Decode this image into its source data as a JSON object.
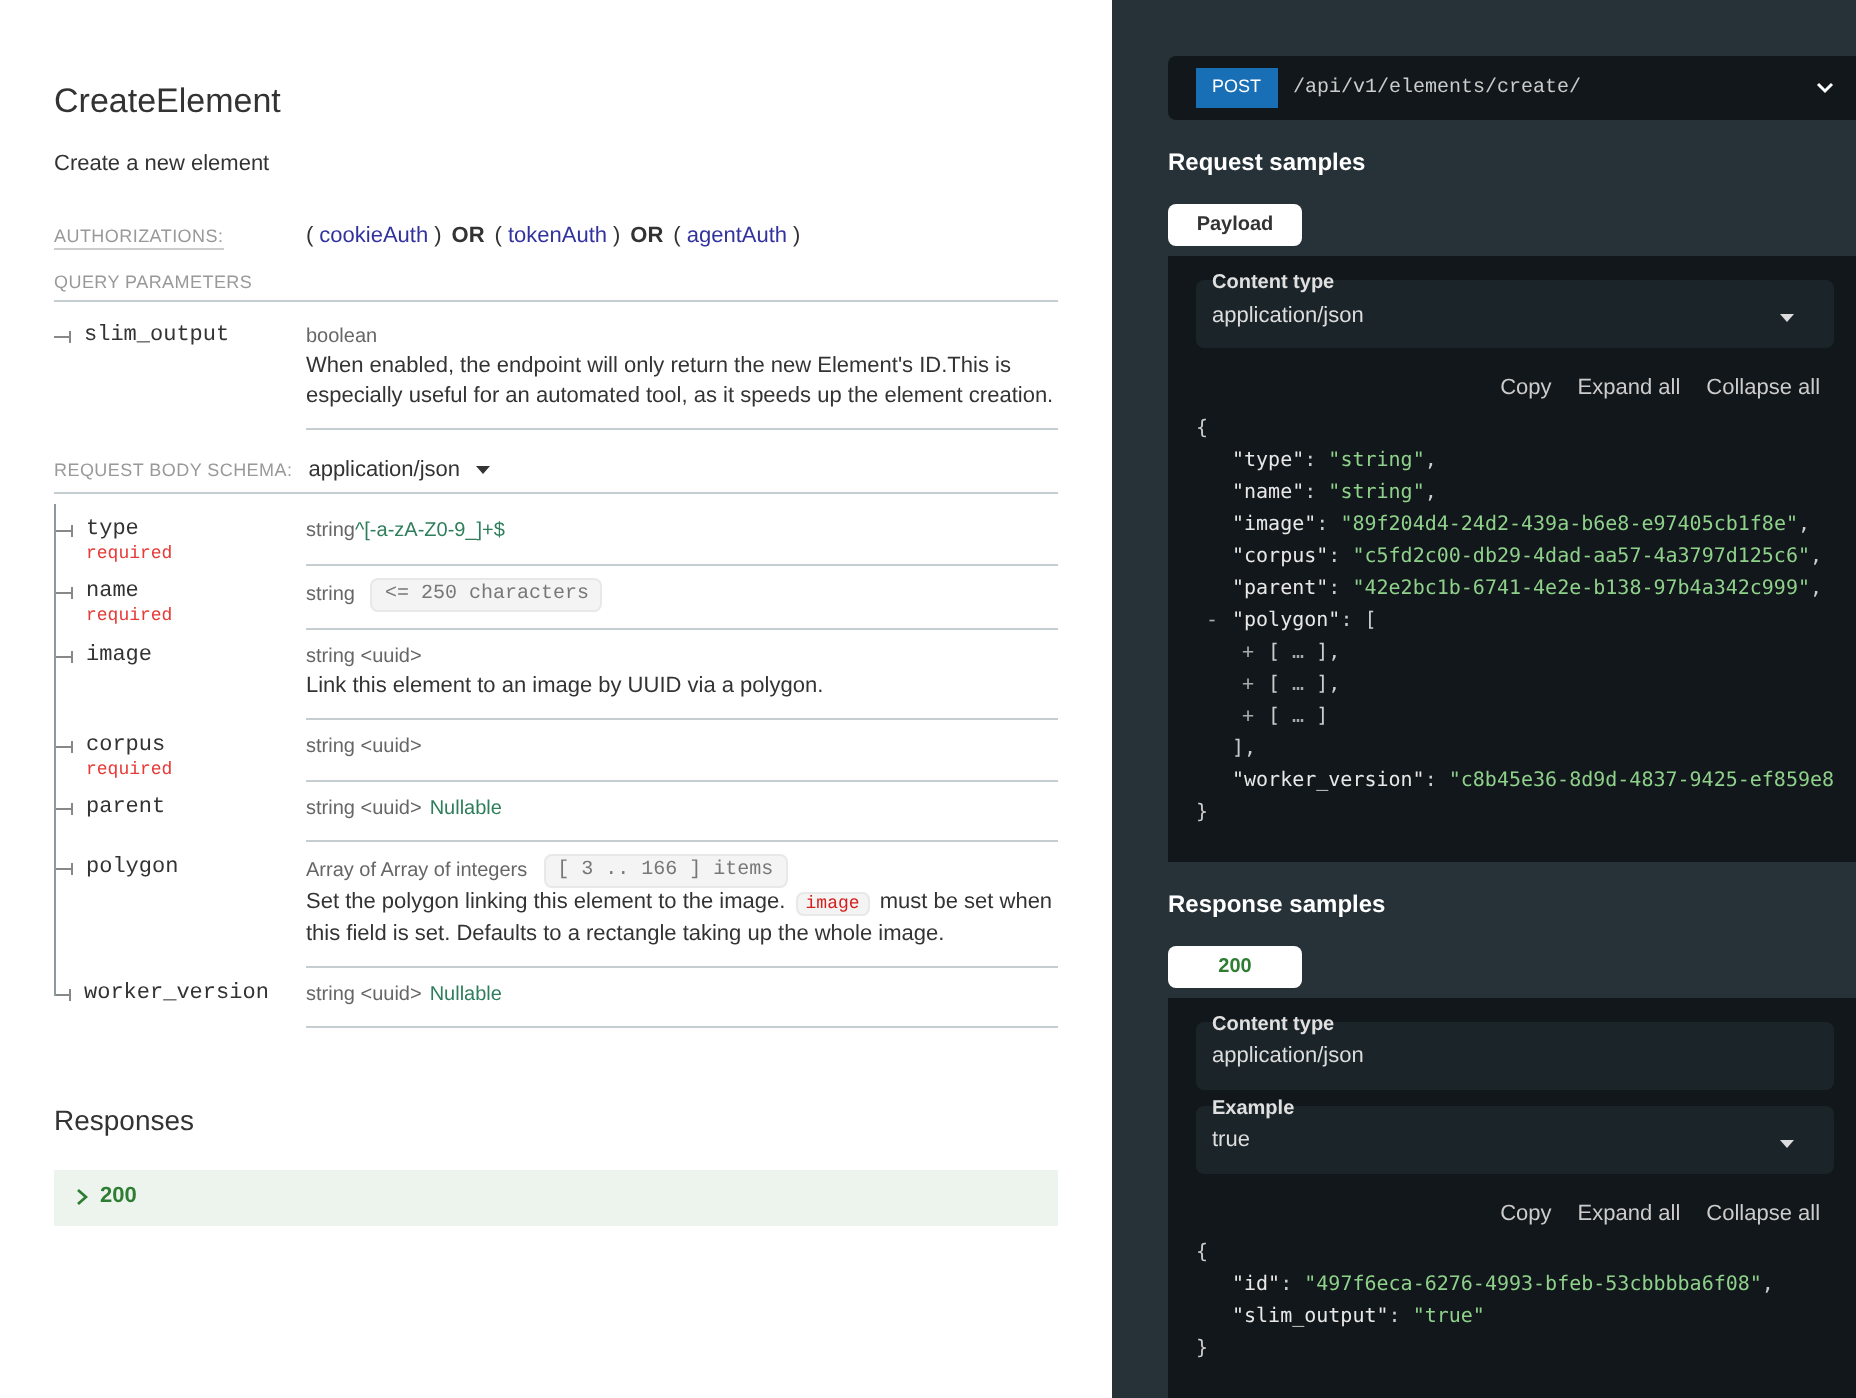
{
  "title": "CreateElement",
  "description": "Create a new element",
  "authorizations": {
    "label": "AUTHORIZATIONS:",
    "parts": [
      {
        "kind": "punct",
        "text": "("
      },
      {
        "kind": "scheme",
        "text": "cookieAuth"
      },
      {
        "kind": "punct",
        "text": ")"
      },
      {
        "kind": "op",
        "text": "OR"
      },
      {
        "kind": "punct",
        "text": "("
      },
      {
        "kind": "scheme",
        "text": "tokenAuth"
      },
      {
        "kind": "punct",
        "text": ")"
      },
      {
        "kind": "op",
        "text": "OR"
      },
      {
        "kind": "punct",
        "text": "("
      },
      {
        "kind": "scheme",
        "text": "agentAuth"
      },
      {
        "kind": "punct",
        "text": ")"
      }
    ]
  },
  "query_parameters": {
    "heading": "QUERY PARAMETERS",
    "params": [
      {
        "name": "slim_output",
        "type": [
          {
            "kind": "text",
            "text": "boolean"
          }
        ],
        "description": [
          {
            "kind": "text",
            "text": "When enabled, the endpoint will only return the new Element's ID.This is especially useful for an automated tool, as it speeds up the element creation."
          }
        ]
      }
    ]
  },
  "request_body": {
    "label": "REQUEST BODY SCHEMA:",
    "content_type": "application/json",
    "fields": [
      {
        "name": "type",
        "badge": "required",
        "type": [
          {
            "kind": "text",
            "text": "string"
          },
          {
            "kind": "pattern",
            "text": "^[-a-zA-Z0-9_]+$"
          }
        ]
      },
      {
        "name": "name",
        "badge": "required",
        "type": [
          {
            "kind": "text",
            "text": "string"
          },
          {
            "kind": "constraint",
            "text": "<= 250 characters"
          }
        ]
      },
      {
        "name": "image",
        "type": [
          {
            "kind": "text",
            "text": "string <uuid>"
          }
        ],
        "description": [
          {
            "kind": "text",
            "text": "Link this element to an image by UUID via a polygon."
          }
        ]
      },
      {
        "name": "corpus",
        "badge": "required",
        "type": [
          {
            "kind": "text",
            "text": "string <uuid>"
          }
        ]
      },
      {
        "name": "parent",
        "type": [
          {
            "kind": "text",
            "text": "string <uuid>"
          },
          {
            "kind": "nullable",
            "text": "Nullable"
          }
        ]
      },
      {
        "name": "polygon",
        "type": [
          {
            "kind": "text",
            "text": "Array of Array of integers"
          },
          {
            "kind": "constraint",
            "text": "[ 3 .. 166 ] items"
          }
        ],
        "description": [
          {
            "kind": "text",
            "text": "Set the polygon linking this element to the image. "
          },
          {
            "kind": "code",
            "text": "image"
          },
          {
            "kind": "text",
            "text": " must be set when this field is set. Defaults to a rectangle taking up the whole image."
          }
        ]
      },
      {
        "name": "worker_version",
        "type": [
          {
            "kind": "text",
            "text": "string <uuid>"
          },
          {
            "kind": "nullable",
            "text": "Nullable"
          }
        ]
      }
    ]
  },
  "responses": {
    "title": "Responses",
    "items": [
      {
        "code": "200",
        "expanded": false
      }
    ]
  },
  "endpoint": {
    "method": "POST",
    "path": "/api/v1/elements/create/"
  },
  "request_samples": {
    "title": "Request samples",
    "tabs": [
      {
        "label": "Payload",
        "selected": true,
        "kind": "plain"
      }
    ],
    "selects": [
      {
        "label": "Content type",
        "value": "application/json",
        "dropdown": true
      }
    ],
    "actions": [
      "Copy",
      "Expand all",
      "Collapse all"
    ],
    "code": [
      {
        "tokens": [
          {
            "kind": "punct",
            "text": "{"
          }
        ],
        "children": [
          {
            "tokens": [
              {
                "kind": "key",
                "text": "\"type\""
              },
              {
                "kind": "punct",
                "text": ": "
              },
              {
                "kind": "string",
                "text": "\"string\""
              },
              {
                "kind": "punct",
                "text": ","
              }
            ]
          },
          {
            "tokens": [
              {
                "kind": "key",
                "text": "\"name\""
              },
              {
                "kind": "punct",
                "text": ": "
              },
              {
                "kind": "string",
                "text": "\"string\""
              },
              {
                "kind": "punct",
                "text": ","
              }
            ]
          },
          {
            "tokens": [
              {
                "kind": "key",
                "text": "\"image\""
              },
              {
                "kind": "punct",
                "text": ": "
              },
              {
                "kind": "string",
                "text": "\"89f204d4-24d2-439a-b6e8-e97405cb1f8e\""
              },
              {
                "kind": "punct",
                "text": ","
              }
            ]
          },
          {
            "tokens": [
              {
                "kind": "key",
                "text": "\"corpus\""
              },
              {
                "kind": "punct",
                "text": ": "
              },
              {
                "kind": "string",
                "text": "\"c5fd2c00-db29-4dad-aa57-4a3797d125c6\""
              },
              {
                "kind": "punct",
                "text": ","
              }
            ]
          },
          {
            "tokens": [
              {
                "kind": "key",
                "text": "\"parent\""
              },
              {
                "kind": "punct",
                "text": ": "
              },
              {
                "kind": "string",
                "text": "\"42e2bc1b-6741-4e2e-b138-97b4a342c999\""
              },
              {
                "kind": "punct",
                "text": ","
              }
            ]
          },
          {
            "toggle": "-",
            "tokens": [
              {
                "kind": "key",
                "text": "\"polygon\""
              },
              {
                "kind": "punct",
                "text": ": ["
              }
            ],
            "children": [
              {
                "toggle": "+",
                "tokens": [
                  {
                    "kind": "punct",
                    "text": "[ "
                  },
                  {
                    "kind": "ellipsis",
                    "text": "…"
                  },
                  {
                    "kind": "punct",
                    "text": " ],"
                  }
                ]
              },
              {
                "toggle": "+",
                "tokens": [
                  {
                    "kind": "punct",
                    "text": "[ "
                  },
                  {
                    "kind": "ellipsis",
                    "text": "…"
                  },
                  {
                    "kind": "punct",
                    "text": " ],"
                  }
                ]
              },
              {
                "toggle": "+",
                "tokens": [
                  {
                    "kind": "punct",
                    "text": "[ "
                  },
                  {
                    "kind": "ellipsis",
                    "text": "…"
                  },
                  {
                    "kind": "punct",
                    "text": " ]"
                  }
                ]
              }
            ]
          },
          {
            "tokens": [
              {
                "kind": "punct",
                "text": "],"
              }
            ]
          },
          {
            "tokens": [
              {
                "kind": "key",
                "text": "\"worker_version\""
              },
              {
                "kind": "punct",
                "text": ": "
              },
              {
                "kind": "string",
                "text": "\"c8b45e36-8d9d-4837-9425-ef859e8"
              }
            ]
          }
        ]
      },
      {
        "tokens": [
          {
            "kind": "punct",
            "text": "}"
          }
        ]
      }
    ]
  },
  "response_samples": {
    "title": "Response samples",
    "tabs": [
      {
        "label": "200",
        "selected": true,
        "kind": "success"
      }
    ],
    "selects": [
      {
        "label": "Content type",
        "value": "application/json",
        "dropdown": false
      },
      {
        "label": "Example",
        "value": "true",
        "dropdown": true
      }
    ],
    "actions": [
      "Copy",
      "Expand all",
      "Collapse all"
    ],
    "code": [
      {
        "tokens": [
          {
            "kind": "punct",
            "text": "{"
          }
        ],
        "children": [
          {
            "tokens": [
              {
                "kind": "key",
                "text": "\"id\""
              },
              {
                "kind": "punct",
                "text": ": "
              },
              {
                "kind": "string",
                "text": "\"497f6eca-6276-4993-bfeb-53cbbbba6f08\""
              },
              {
                "kind": "punct",
                "text": ","
              }
            ]
          },
          {
            "tokens": [
              {
                "kind": "key",
                "text": "\"slim_output\""
              },
              {
                "kind": "punct",
                "text": ": "
              },
              {
                "kind": "string",
                "text": "\"true\""
              }
            ]
          }
        ]
      },
      {
        "tokens": [
          {
            "kind": "punct",
            "text": "}"
          }
        ]
      }
    ]
  }
}
